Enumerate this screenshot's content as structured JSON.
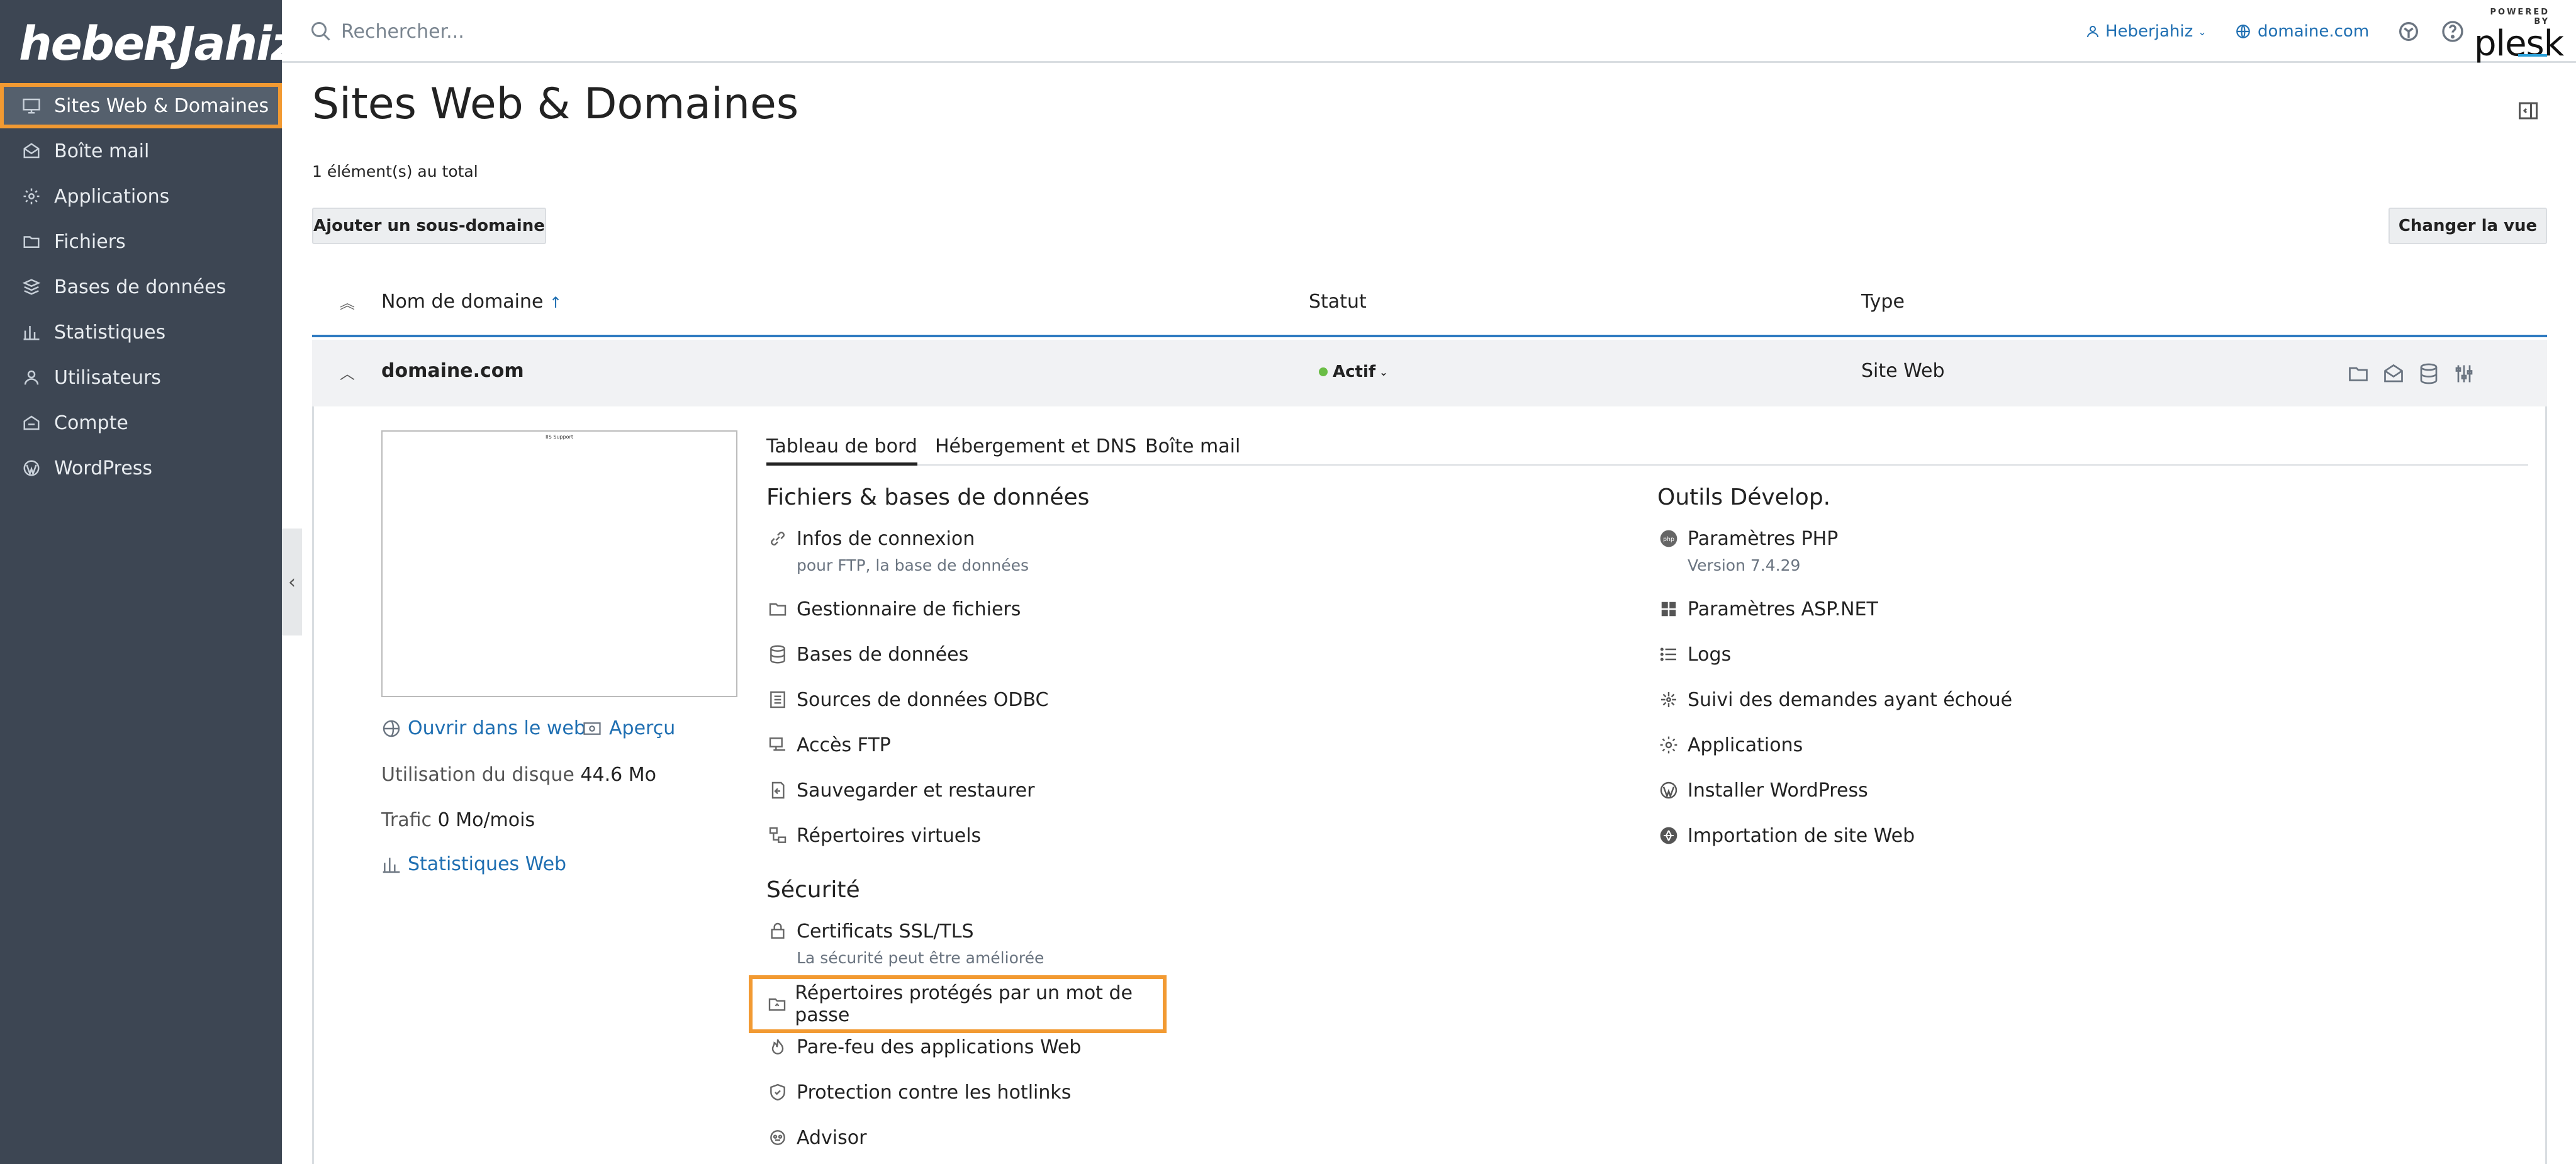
{
  "brand": {
    "logo_text": "hebeRJahiz",
    "powered_by": "POWERED BY",
    "plesk": "plesk"
  },
  "sidebar": {
    "items": [
      {
        "label": "Sites Web & Domaines",
        "icon": "monitor-icon",
        "active": true
      },
      {
        "label": "Boîte mail",
        "icon": "mail-icon"
      },
      {
        "label": "Applications",
        "icon": "gear-icon"
      },
      {
        "label": "Fichiers",
        "icon": "folder-icon"
      },
      {
        "label": "Bases de données",
        "icon": "database-icon"
      },
      {
        "label": "Statistiques",
        "icon": "bar-chart-icon"
      },
      {
        "label": "Utilisateurs",
        "icon": "user-icon"
      },
      {
        "label": "Compte",
        "icon": "account-icon"
      },
      {
        "label": "WordPress",
        "icon": "wordpress-icon"
      }
    ]
  },
  "topbar": {
    "search_placeholder": "Rechercher...",
    "user": "Heberjahiz",
    "domain": "domaine.com"
  },
  "page": {
    "title": "Sites Web & Domaines",
    "total": "1 élément(s) au total",
    "add_subdomain": "Ajouter un sous-domaine",
    "change_view": "Changer la vue"
  },
  "table": {
    "col_domain": "Nom de domaine",
    "col_status": "Statut",
    "col_type": "Type",
    "row": {
      "domain": "domaine.com",
      "status": "Actif",
      "type": "Site Web"
    }
  },
  "detail": {
    "preview_text": "IIS Support",
    "open_web": "Ouvrir dans le web",
    "preview": "Aperçu",
    "disk_label": "Utilisation du disque",
    "disk_value": "44.6 Mo",
    "traffic_label": "Trafic",
    "traffic_value": "0 Mo/mois",
    "web_stats": "Statistiques Web",
    "tabs": [
      "Tableau de bord",
      "Hébergement et DNS",
      "Boîte mail"
    ],
    "files_title": "Fichiers & bases de données",
    "files_tools": [
      {
        "label": "Infos de connexion",
        "sub": "pour FTP, la base de données",
        "icon": "link-icon"
      },
      {
        "label": "Gestionnaire de fichiers",
        "icon": "folder-icon"
      },
      {
        "label": "Bases de données",
        "icon": "database-icon"
      },
      {
        "label": "Sources de données ODBC",
        "icon": "odbc-icon"
      },
      {
        "label": "Accès FTP",
        "icon": "ftp-icon"
      },
      {
        "label": "Sauvegarder et restaurer",
        "icon": "backup-icon"
      },
      {
        "label": "Répertoires virtuels",
        "icon": "virtual-dir-icon"
      }
    ],
    "security_title": "Sécurité",
    "security_tools": [
      {
        "label": "Certificats SSL/TLS",
        "sub": "La sécurité peut être améliorée",
        "icon": "certificate-icon"
      },
      {
        "label": "Répertoires protégés par un mot de passe",
        "icon": "protected-folder-icon",
        "highlight": true
      },
      {
        "label": "Pare-feu des applications Web",
        "icon": "flame-icon"
      },
      {
        "label": "Protection contre les hotlinks",
        "icon": "shield-icon"
      },
      {
        "label": "Advisor",
        "icon": "advisor-icon"
      }
    ],
    "dev_title": "Outils Dévelop.",
    "dev_tools": [
      {
        "label": "Paramètres PHP",
        "sub": "Version 7.4.29",
        "icon": "php-icon"
      },
      {
        "label": "Paramètres ASP.NET",
        "icon": "windows-icon"
      },
      {
        "label": "Logs",
        "icon": "list-icon"
      },
      {
        "label": "Suivi des demandes ayant échoué",
        "icon": "bug-icon"
      },
      {
        "label": "Applications",
        "icon": "gear-icon"
      },
      {
        "label": "Installer WordPress",
        "icon": "wordpress-icon"
      },
      {
        "label": "Importation de site Web",
        "icon": "globe-import-icon"
      }
    ]
  }
}
